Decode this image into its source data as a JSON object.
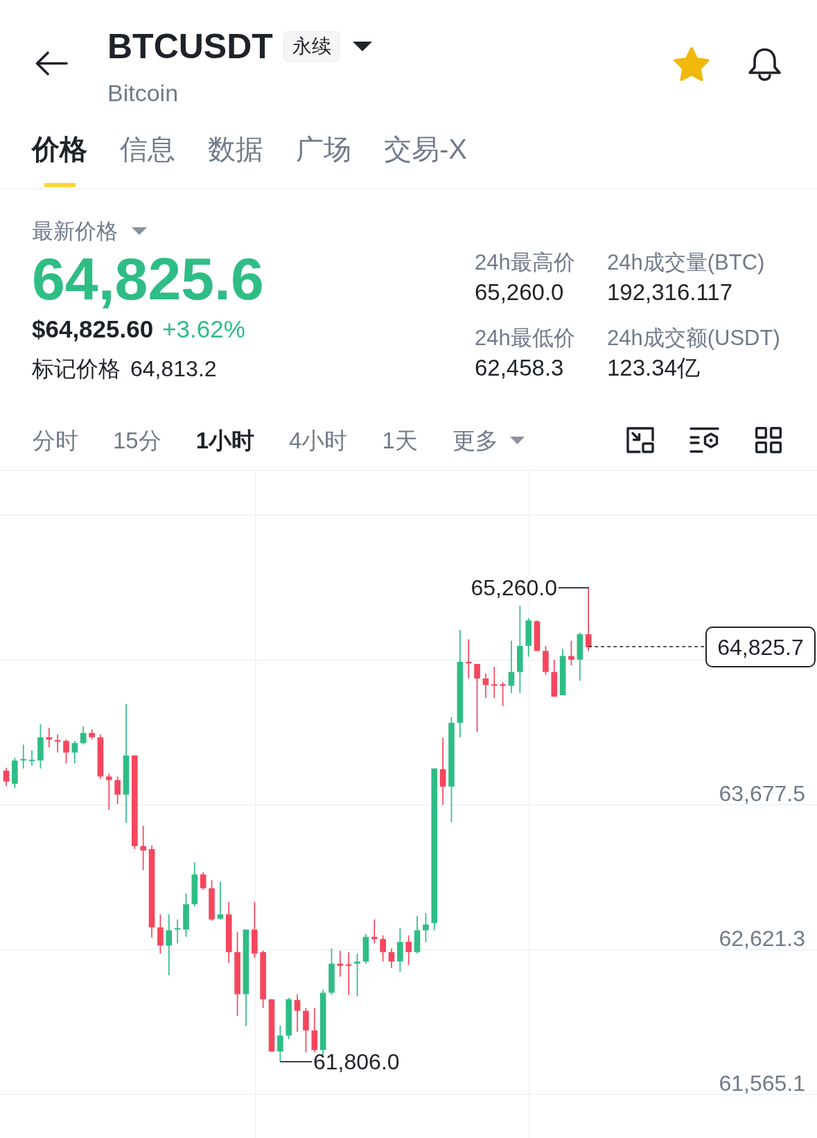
{
  "header": {
    "symbol": "BTCUSDT",
    "contract_type": "永续",
    "name": "Bitcoin",
    "favorite": true
  },
  "tabs": [
    {
      "label": "价格",
      "selected": true
    },
    {
      "label": "信息",
      "selected": false
    },
    {
      "label": "数据",
      "selected": false
    },
    {
      "label": "广场",
      "selected": false
    },
    {
      "label": "交易-X",
      "selected": false
    }
  ],
  "price": {
    "selector": "最新价格",
    "last": "64,825.6",
    "rising": true,
    "usd_value": "$64,825.60",
    "change": "+3.62%",
    "mark_label": "标记价格",
    "mark_value": "64,813.2"
  },
  "stats": [
    {
      "label": "24h最高价",
      "value": "65,260.0"
    },
    {
      "label": "24h成交量(BTC)",
      "value": "192,316.117"
    },
    {
      "label": "24h最低价",
      "value": "62,458.3"
    },
    {
      "label": "24h成交额(USDT)",
      "value": "123.34亿"
    }
  ],
  "intervals": [
    {
      "label": "分时",
      "selected": false
    },
    {
      "label": "15分",
      "selected": false
    },
    {
      "label": "1小时",
      "selected": true
    },
    {
      "label": "4小时",
      "selected": false
    },
    {
      "label": "1天",
      "selected": false
    }
  ],
  "more_menu": {
    "label": "更多"
  },
  "chart": {
    "y_axis_labels": [
      "63,677.5",
      "62,621.3",
      "61,565.1"
    ],
    "high_marker": "65,260.0",
    "low_marker": "61,806.0",
    "last_price_tag": "64,825.7"
  }
}
